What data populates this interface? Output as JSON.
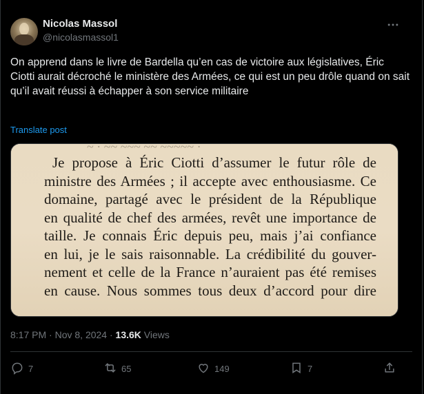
{
  "tweet": {
    "author_name": "Nicolas Massol",
    "author_handle": "@nicolasmassol1",
    "text": "On apprend dans le livre de Bardella qu’en cas de victoire aux législatives, Éric Ciotti aurait décroché le ministère des Armées, ce qui est un peu drôle quand on sait qu’il avait réussi à échapper à son service militaire",
    "translate_label": "Translate post",
    "time": "8:17 PM",
    "date": "Nov 8, 2024",
    "views_count": "13.6K",
    "views_label": "Views"
  },
  "media": {
    "book_lines": [
      "Je propose à Éric Ciotti d’assumer le futur rôle de",
      "ministre des Armées ; il accepte avec enthousiasme. Ce",
      "domaine, partagé avec le président de la République",
      "en qualité de chef des armées, revêt une importance de",
      "taille. Je connais Éric depuis peu, mais j’ai confiance",
      "en lui, je le sais raisonnable. La crédibilité du gouver-",
      "nement et celle de la France n’auraient pas été remises",
      "en cause. Nous sommes tous deux d’accord pour dire"
    ]
  },
  "actions": {
    "reply_count": "7",
    "repost_count": "65",
    "like_count": "149",
    "bookmark_count": "7"
  },
  "icons": [
    "more-icon",
    "reply-icon",
    "repost-icon",
    "like-icon",
    "bookmark-icon",
    "share-icon"
  ],
  "colors": {
    "background": "#000000",
    "text": "#e7e9ea",
    "muted": "#71767b",
    "link": "#1d9bf0",
    "border": "#2f3336"
  }
}
